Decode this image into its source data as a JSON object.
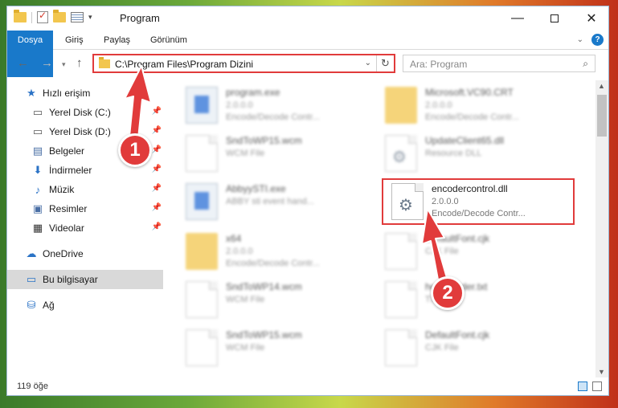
{
  "window": {
    "title": "Program"
  },
  "ribbon": {
    "tabs": [
      "Dosya",
      "Giriş",
      "Paylaş",
      "Görünüm"
    ]
  },
  "address": {
    "path": "C:\\Program Files\\Program Dizini"
  },
  "search": {
    "placeholder": "Ara: Program"
  },
  "sidebar": {
    "items": [
      {
        "label": "Hızlı erişim",
        "icon": "star-icon"
      },
      {
        "label": "Yerel Disk (C:)",
        "icon": "drive-icon"
      },
      {
        "label": "Yerel Disk (D:)",
        "icon": "drive-icon"
      },
      {
        "label": "Belgeler",
        "icon": "documents-icon"
      },
      {
        "label": "İndirmeler",
        "icon": "download-icon"
      },
      {
        "label": "Müzik",
        "icon": "music-icon"
      },
      {
        "label": "Resimler",
        "icon": "pictures-icon"
      },
      {
        "label": "Videolar",
        "icon": "videos-icon"
      },
      {
        "label": "OneDrive",
        "icon": "cloud-icon"
      },
      {
        "label": "Bu bilgisayar",
        "icon": "computer-icon"
      },
      {
        "label": "Ağ",
        "icon": "network-icon"
      }
    ]
  },
  "files": [
    {
      "name": "program.exe",
      "line2": "2.0.0.0",
      "line3": "Encode/Decode Contr..."
    },
    {
      "name": "Microsoft.VC90.CRT",
      "line2": "2.0.0.0",
      "line3": "Encode/Decode Contr..."
    },
    {
      "name": "SndToWP15.wcm",
      "line2": "WCM File",
      "line3": ""
    },
    {
      "name": "UpdateClient65.dll",
      "line2": "Resource DLL",
      "line3": ""
    },
    {
      "name": "AbbyySTI.exe",
      "line2": "ABBY sti event hand...",
      "line3": ""
    },
    {
      "name": "encodercontrol.dll",
      "line2": "2.0.0.0",
      "line3": "Encode/Decode Contr..."
    },
    {
      "name": "x64",
      "line2": "2.0.0.0",
      "line3": "Encode/Decode Contr..."
    },
    {
      "name": "DefaultFont.cjk",
      "line2": "CJK File",
      "line3": ""
    },
    {
      "name": "SndToWP14.wcm",
      "line2": "WCM File",
      "line3": ""
    },
    {
      "name": "helpReader.txt",
      "line2": "TXT File",
      "line3": ""
    },
    {
      "name": "SndToWP15.wcm",
      "line2": "WCM File",
      "line3": ""
    },
    {
      "name": "DefaultFont.cjk",
      "line2": "CJK File",
      "line3": ""
    }
  ],
  "status": {
    "count": "119 öğe"
  },
  "annotations": {
    "badge1": "1",
    "badge2": "2",
    "color": "#e13b3b"
  }
}
